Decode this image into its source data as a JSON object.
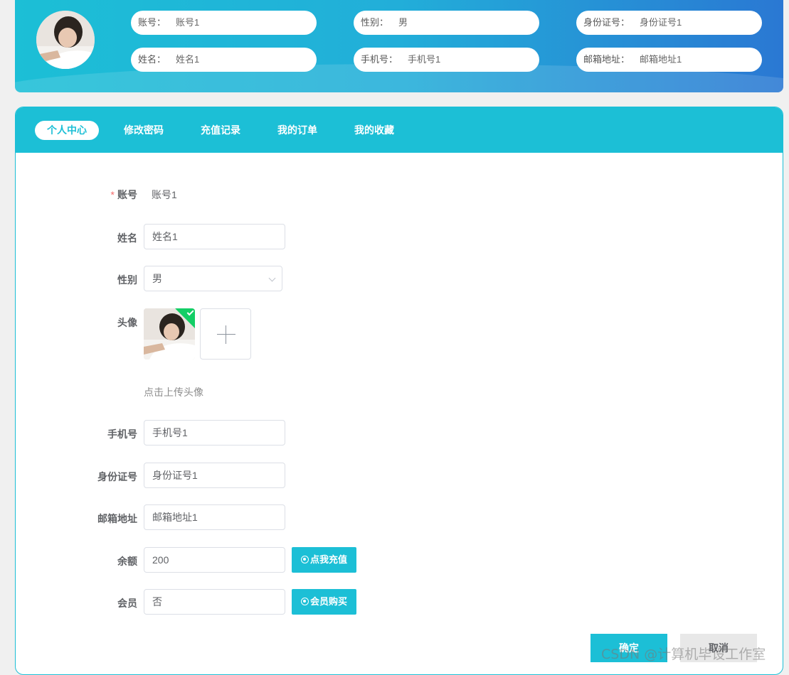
{
  "header": {
    "info": [
      {
        "label": "账号：",
        "value": "账号1"
      },
      {
        "label": "性别：",
        "value": "男"
      },
      {
        "label": "身份证号：",
        "value": "身份证号1"
      },
      {
        "label": "姓名：",
        "value": "姓名1"
      },
      {
        "label": "手机号：",
        "value": "手机号1"
      },
      {
        "label": "邮箱地址：",
        "value": "邮箱地址1"
      }
    ]
  },
  "tabs": [
    "个人中心",
    "修改密码",
    "充值记录",
    "我的订单",
    "我的收藏"
  ],
  "form": {
    "account": {
      "label": "账号",
      "value": "账号1",
      "required_mark": "*"
    },
    "name": {
      "label": "姓名",
      "value": "姓名1"
    },
    "gender": {
      "label": "性别",
      "value": "男"
    },
    "avatar": {
      "label": "头像",
      "hint": "点击上传头像"
    },
    "phone": {
      "label": "手机号",
      "value": "手机号1"
    },
    "id_card": {
      "label": "身份证号",
      "value": "身份证号1"
    },
    "email": {
      "label": "邮箱地址",
      "value": "邮箱地址1"
    },
    "balance": {
      "label": "余额",
      "value": "200",
      "button": "点我充值"
    },
    "member": {
      "label": "会员",
      "value": "否",
      "button": "会员购买"
    }
  },
  "actions": {
    "confirm": "确定",
    "cancel": "取消"
  },
  "watermark": "CSDN @计算机毕设工作室",
  "colors": {
    "accent": "#1cbfd6",
    "success": "#13ce66",
    "required": "#f56c6c"
  }
}
